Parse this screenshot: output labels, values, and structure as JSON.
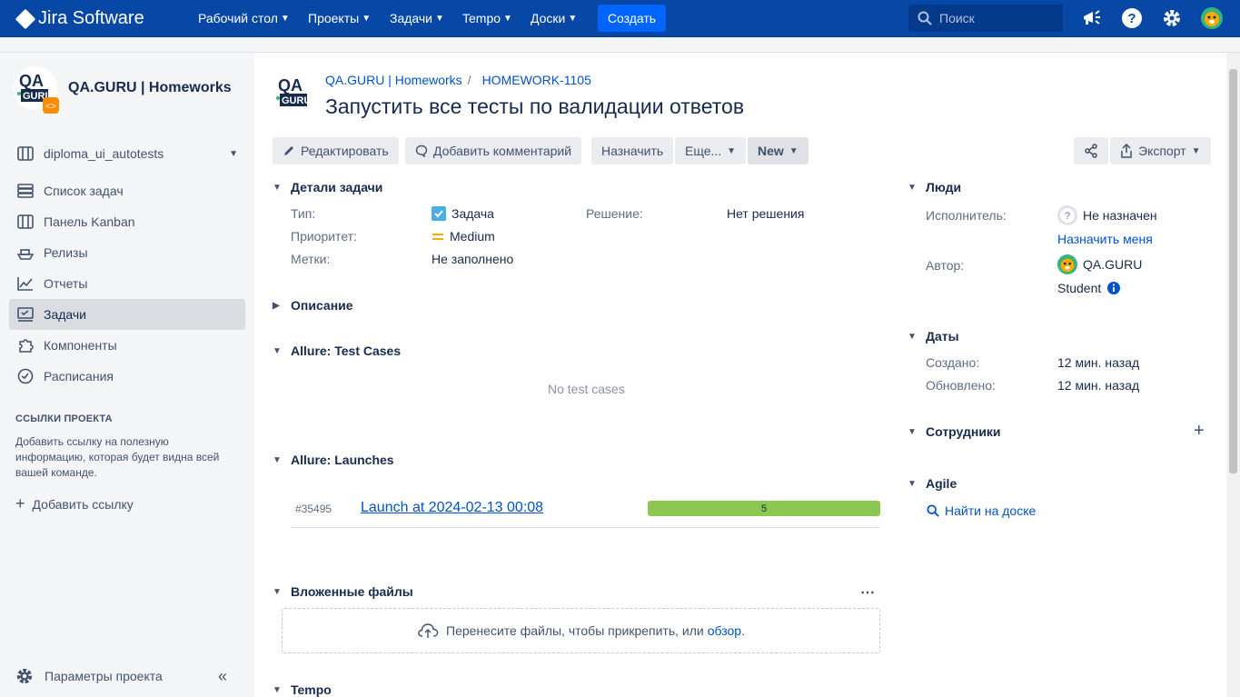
{
  "topbar": {
    "product": "Jira Software",
    "nav": [
      "Рабочий стол",
      "Проекты",
      "Задачи",
      "Tempo",
      "Доски"
    ],
    "create": "Создать",
    "search_placeholder": "Поиск"
  },
  "sidebar": {
    "project_name": "QA.GURU | Homeworks",
    "board": "diploma_ui_autotests",
    "items": [
      {
        "label": "Список задач",
        "icon": "backlog-icon"
      },
      {
        "label": "Панель Kanban",
        "icon": "board-icon"
      },
      {
        "label": "Релизы",
        "icon": "ship-icon"
      },
      {
        "label": "Отчеты",
        "icon": "chart-icon"
      },
      {
        "label": "Задачи",
        "icon": "issues-icon",
        "active": true
      },
      {
        "label": "Компоненты",
        "icon": "puzzle-icon"
      },
      {
        "label": "Расписания",
        "icon": "clock-icon"
      }
    ],
    "links_heading": "ССЫЛКИ ПРОЕКТА",
    "links_desc": "Добавить ссылку на полезную информацию, которая будет видна всей вашей команде.",
    "add_link": "Добавить ссылку",
    "settings": "Параметры проекта"
  },
  "issue": {
    "breadcrumb_project": "QA.GURU | Homeworks",
    "breadcrumb_sep": "/",
    "key": "HOMEWORK-1105",
    "title": "Запустить все тесты по валидации ответов"
  },
  "toolbar": {
    "edit": "Редактировать",
    "comment": "Добавить комментарий",
    "assign": "Назначить",
    "more": "Еще...",
    "status": "New",
    "export": "Экспорт"
  },
  "details": {
    "heading": "Детали задачи",
    "type_label": "Тип:",
    "type_value": "Задача",
    "priority_label": "Приоритет:",
    "priority_value": "Medium",
    "labels_label": "Метки:",
    "labels_value": "Не заполнено",
    "resolution_label": "Решение:",
    "resolution_value": "Нет решения"
  },
  "description": {
    "heading": "Описание"
  },
  "allure_cases": {
    "heading": "Allure: Test Cases",
    "empty": "No test cases"
  },
  "allure_launches": {
    "heading": "Allure: Launches",
    "launch_id": "#35495",
    "launch_name": "Launch at 2024-02-13 00:08",
    "count": "5"
  },
  "attachments": {
    "heading": "Вложенные файлы",
    "drop_text": "Перенесите файлы, чтобы прикрепить, или",
    "browse": "обзор",
    "dot": "."
  },
  "tempo": {
    "heading": "Tempo"
  },
  "people": {
    "heading": "Люди",
    "assignee_label": "Исполнитель:",
    "assignee": "Не назначен",
    "assign_me": "Назначить меня",
    "reporter_label": "Автор:",
    "reporter_line1": "QA.GURU",
    "reporter_line2": "Student"
  },
  "dates": {
    "heading": "Даты",
    "created_label": "Создано:",
    "created": "12 мин. назад",
    "updated_label": "Обновлено:",
    "updated": "12 мин. назад"
  },
  "staff": {
    "heading": "Сотрудники"
  },
  "agile": {
    "heading": "Agile",
    "find": "Найти на доске"
  },
  "colors": {
    "topbar": "#0747a6",
    "create": "#0065ff",
    "link": "#0052cc",
    "progress": "#8bc751"
  }
}
